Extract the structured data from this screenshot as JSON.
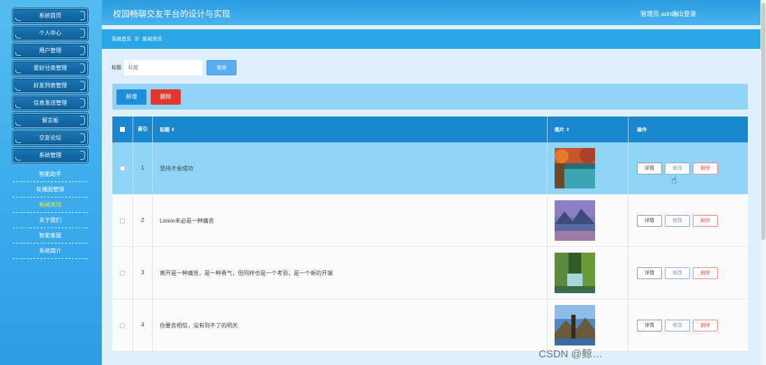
{
  "app": {
    "title": "校园畅聊交友平台的设计与实现",
    "user_label": "管理员 admin",
    "logout_label": "退出登录"
  },
  "sidebar": {
    "items": [
      {
        "label": "系统首页"
      },
      {
        "label": "个人中心"
      },
      {
        "label": "用户管理"
      },
      {
        "label": "爱好分类管理"
      },
      {
        "label": "好友列表管理"
      },
      {
        "label": "信息发送管理"
      },
      {
        "label": "留言板"
      },
      {
        "label": "交友论坛"
      },
      {
        "label": "系统管理"
      }
    ],
    "subitems": [
      {
        "label": "智能助手"
      },
      {
        "label": "轮播图管理"
      },
      {
        "label": "新闻资讯",
        "active": true
      },
      {
        "label": "关于我们"
      },
      {
        "label": "智能客服"
      },
      {
        "label": "系统简介"
      }
    ]
  },
  "breadcrumb": {
    "home": "系统首页",
    "separator": "☰",
    "current": "新闻资讯"
  },
  "search": {
    "label": "标题",
    "placeholder": "标题",
    "button": "查询"
  },
  "actions": {
    "add": "新增",
    "delete": "删除"
  },
  "table": {
    "headers": {
      "index": "索引",
      "title": "标题 ⇕",
      "image": "图片 ⇕",
      "ops": "操作"
    },
    "rows": [
      {
        "index": "1",
        "title": "坚持才会成功"
      },
      {
        "index": "2",
        "title": "Leave未必是一种痛苦"
      },
      {
        "index": "3",
        "title": "离开是一种痛苦，是一种勇气，但同样也是一个考验，是一个新的开端"
      },
      {
        "index": "4",
        "title": "你要去相信，没有到不了的明天"
      }
    ],
    "op_labels": {
      "detail": "详情",
      "edit": "修改",
      "delete": "删除"
    }
  },
  "watermark": "CSDN @鲸…"
}
